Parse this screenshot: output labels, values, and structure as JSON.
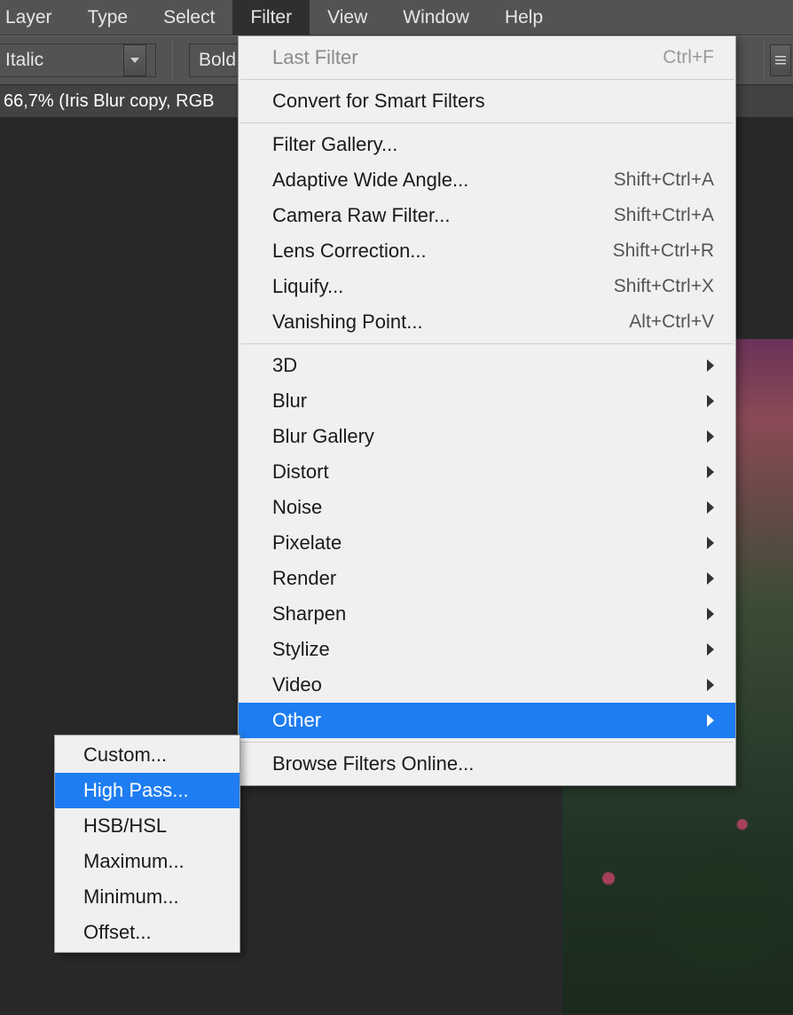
{
  "menubar": {
    "items": [
      "Layer",
      "Type",
      "Select",
      "Filter",
      "View",
      "Window",
      "Help"
    ],
    "activeIndex": 3
  },
  "optionsbar": {
    "fontStyle1": "  Italic",
    "fontStyle2": "Bold I"
  },
  "doctab": {
    "label": "66,7% (Iris Blur copy, RGB"
  },
  "filterMenu": {
    "groups": [
      [
        {
          "label": "Last Filter",
          "shortcut": "Ctrl+F",
          "disabled": true
        }
      ],
      [
        {
          "label": "Convert for Smart Filters"
        }
      ],
      [
        {
          "label": "Filter Gallery..."
        },
        {
          "label": "Adaptive Wide Angle...",
          "shortcut": "Shift+Ctrl+A"
        },
        {
          "label": "Camera Raw Filter...",
          "shortcut": "Shift+Ctrl+A"
        },
        {
          "label": "Lens Correction...",
          "shortcut": "Shift+Ctrl+R"
        },
        {
          "label": "Liquify...",
          "shortcut": "Shift+Ctrl+X"
        },
        {
          "label": "Vanishing Point...",
          "shortcut": "Alt+Ctrl+V"
        }
      ],
      [
        {
          "label": "3D",
          "submenu": true
        },
        {
          "label": "Blur",
          "submenu": true
        },
        {
          "label": "Blur Gallery",
          "submenu": true
        },
        {
          "label": "Distort",
          "submenu": true
        },
        {
          "label": "Noise",
          "submenu": true
        },
        {
          "label": "Pixelate",
          "submenu": true
        },
        {
          "label": "Render",
          "submenu": true
        },
        {
          "label": "Sharpen",
          "submenu": true
        },
        {
          "label": "Stylize",
          "submenu": true
        },
        {
          "label": "Video",
          "submenu": true
        },
        {
          "label": "Other",
          "submenu": true,
          "highlight": true
        }
      ],
      [
        {
          "label": "Browse Filters Online..."
        }
      ]
    ]
  },
  "otherSubmenu": {
    "items": [
      {
        "label": "Custom..."
      },
      {
        "label": "High Pass...",
        "highlight": true
      },
      {
        "label": "HSB/HSL"
      },
      {
        "label": "Maximum..."
      },
      {
        "label": "Minimum..."
      },
      {
        "label": "Offset..."
      }
    ]
  }
}
